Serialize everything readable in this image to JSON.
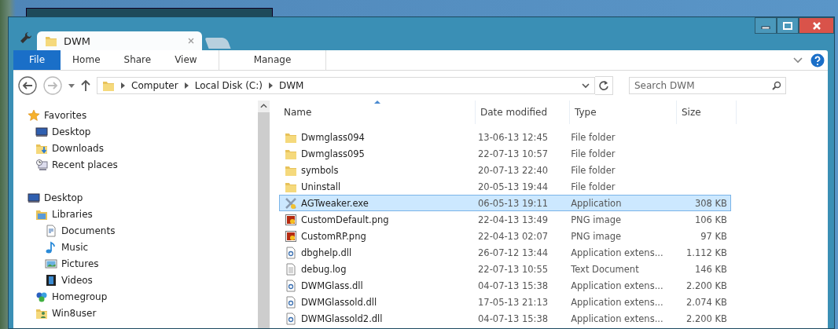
{
  "window": {
    "tab_title": "DWM",
    "tab_selected": true
  },
  "ribbon": {
    "tabs": [
      {
        "label": "File",
        "kind": "file",
        "selected": false
      },
      {
        "label": "Home",
        "kind": "tab",
        "selected": false
      },
      {
        "label": "Share",
        "kind": "tab",
        "selected": false
      },
      {
        "label": "View",
        "kind": "tab",
        "selected": false
      },
      {
        "label": "Manage",
        "kind": "context",
        "selected": false
      }
    ]
  },
  "address_bar": {
    "path": [
      "Computer",
      "Local Disk (C:)",
      "DWM"
    ]
  },
  "search": {
    "placeholder": "Search DWM"
  },
  "sidebar": {
    "items": [
      {
        "label": "Favorites",
        "kind": "star",
        "children": [
          {
            "label": "Desktop",
            "kind": "desktop"
          },
          {
            "label": "Downloads",
            "kind": "downloads"
          },
          {
            "label": "Recent places",
            "kind": "recent"
          }
        ]
      },
      {
        "label": "Desktop",
        "kind": "desktop",
        "children": [
          {
            "label": "Libraries",
            "kind": "libraries",
            "children": [
              {
                "label": "Documents",
                "kind": "documents"
              },
              {
                "label": "Music",
                "kind": "music"
              },
              {
                "label": "Pictures",
                "kind": "pictures"
              },
              {
                "label": "Videos",
                "kind": "videos"
              }
            ]
          },
          {
            "label": "Homegroup",
            "kind": "homegroup"
          },
          {
            "label": "Win8user",
            "kind": "user"
          }
        ]
      }
    ]
  },
  "table": {
    "columns": [
      {
        "label": "Name",
        "sorted": true
      },
      {
        "label": "Date modified",
        "sorted": false
      },
      {
        "label": "Type",
        "sorted": false
      },
      {
        "label": "Size",
        "sorted": false
      }
    ],
    "rows": [
      {
        "kind": "folder",
        "name": "Dwmglass094",
        "date": "13-06-13 12:45",
        "type": "File folder",
        "size": "",
        "selected": false
      },
      {
        "kind": "folder",
        "name": "Dwmglass095",
        "date": "22-07-13 10:57",
        "type": "File folder",
        "size": "",
        "selected": false
      },
      {
        "kind": "folder",
        "name": "symbols",
        "date": "20-07-13 22:40",
        "type": "File folder",
        "size": "",
        "selected": false
      },
      {
        "kind": "folder",
        "name": "Uninstall",
        "date": "20-05-13 19:44",
        "type": "File folder",
        "size": "",
        "selected": false
      },
      {
        "kind": "app",
        "name": "AGTweaker.exe",
        "date": "06-05-13 19:11",
        "type": "Application",
        "size": "308 KB",
        "selected": true
      },
      {
        "kind": "image",
        "name": "CustomDefault.png",
        "date": "22-04-13 13:49",
        "type": "PNG image",
        "size": "106 KB",
        "selected": false
      },
      {
        "kind": "image",
        "name": "CustomRP.png",
        "date": "22-04-13 02:07",
        "type": "PNG image",
        "size": "97 KB",
        "selected": false
      },
      {
        "kind": "dll",
        "name": "dbghelp.dll",
        "date": "26-07-12 13:44",
        "type": "Application extens...",
        "size": "1.112 KB",
        "selected": false
      },
      {
        "kind": "text",
        "name": "debug.log",
        "date": "22-07-13 10:55",
        "type": "Text Document",
        "size": "146 KB",
        "selected": false
      },
      {
        "kind": "dll",
        "name": "DWMGlass.dll",
        "date": "04-07-13 15:38",
        "type": "Application extens...",
        "size": "2.200 KB",
        "selected": false
      },
      {
        "kind": "dll",
        "name": "DWMGlassold.dll",
        "date": "17-05-13 21:13",
        "type": "Application extens...",
        "size": "2.074 KB",
        "selected": false
      },
      {
        "kind": "dll",
        "name": "DWMGlassold2.dll",
        "date": "04-07-13 15:38",
        "type": "Application extens...",
        "size": "2.200 KB",
        "selected": false
      }
    ]
  }
}
